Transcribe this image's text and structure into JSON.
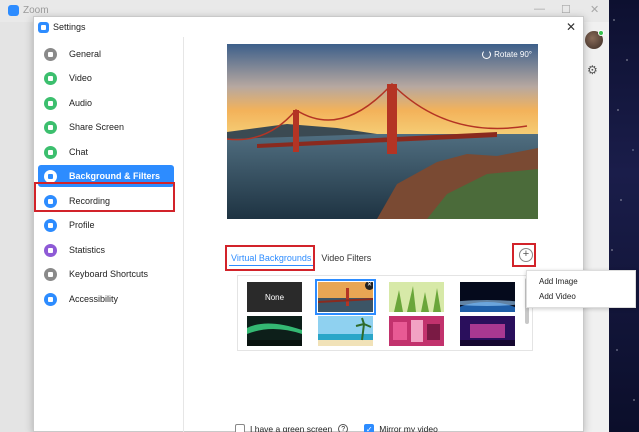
{
  "backdrop": {
    "app_title": "Zoom",
    "minimize": "—",
    "maximize": "☐",
    "close": "✕"
  },
  "window": {
    "title": "Settings",
    "close": "✕"
  },
  "sidebar": {
    "items": [
      {
        "label": "General",
        "icon": "gear-icon",
        "color": "#8a8a8a"
      },
      {
        "label": "Video",
        "icon": "video-icon",
        "color": "#3cbf6e"
      },
      {
        "label": "Audio",
        "icon": "headphones-icon",
        "color": "#3cbf6e"
      },
      {
        "label": "Share Screen",
        "icon": "share-screen-icon",
        "color": "#3cbf6e"
      },
      {
        "label": "Chat",
        "icon": "chat-icon",
        "color": "#3cbf6e"
      },
      {
        "label": "Background & Filters",
        "icon": "background-icon",
        "color": "#ffffff"
      },
      {
        "label": "Recording",
        "icon": "recording-icon",
        "color": "#2d8cff"
      },
      {
        "label": "Profile",
        "icon": "profile-icon",
        "color": "#2d8cff"
      },
      {
        "label": "Statistics",
        "icon": "statistics-icon",
        "color": "#8e5ad6"
      },
      {
        "label": "Keyboard Shortcuts",
        "icon": "keyboard-icon",
        "color": "#8a8a8a"
      },
      {
        "label": "Accessibility",
        "icon": "accessibility-icon",
        "color": "#2d8cff"
      }
    ],
    "active_index": 5
  },
  "preview": {
    "rotate_label": "Rotate 90°"
  },
  "tabs": [
    {
      "label": "Virtual Backgrounds",
      "active": true
    },
    {
      "label": "Video Filters",
      "active": false
    }
  ],
  "add_button": {
    "label": "+"
  },
  "thumbnails": {
    "none_label": "None",
    "close_badge": "✕",
    "items": [
      "none",
      "golden-gate",
      "grass",
      "earth",
      "aurora",
      "beach",
      "pink-room",
      "stage"
    ],
    "selected_index": 1
  },
  "add_menu": {
    "items": [
      "Add Image",
      "Add Video"
    ]
  },
  "footer": {
    "green_screen_label": "I have a green screen",
    "green_screen_checked": false,
    "help_icon": "?",
    "mirror_label": "Mirror my video",
    "mirror_checked": true,
    "check_mark": "✓"
  },
  "colors": {
    "accent": "#2d8cff",
    "highlight_red": "#d2232a"
  }
}
